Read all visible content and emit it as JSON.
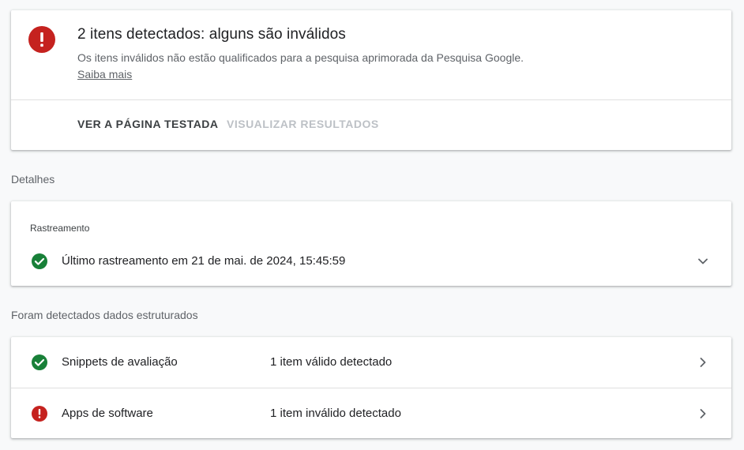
{
  "summary": {
    "title": "2 itens detectados: alguns são inválidos",
    "description": "Os itens inválidos não estão qualificados para a pesquisa aprimorada da Pesquisa Google.",
    "learn_more": "Saiba mais",
    "icon": "error-icon",
    "actions": {
      "view_page": "VER A PÁGINA TESTADA",
      "view_results": "VISUALIZAR RESULTADOS"
    }
  },
  "details": {
    "heading": "Detalhes",
    "crawl": {
      "label": "Rastreamento",
      "status_text": "Último rastreamento em 21 de mai. de 2024, 15:45:59",
      "icon": "check-circle-icon"
    }
  },
  "structured_data": {
    "heading": "Foram detectados dados estruturados",
    "items": [
      {
        "name": "Snippets de avaliação",
        "status": "1 item válido detectado",
        "icon": "check-circle-icon"
      },
      {
        "name": "Apps de software",
        "status": "1 item inválido detectado",
        "icon": "error-icon"
      }
    ]
  },
  "colors": {
    "error": "#c5221f",
    "success": "#188038",
    "primary_text": "#202124",
    "secondary_text": "#5f6368",
    "disabled_text": "#bdc1c6"
  }
}
